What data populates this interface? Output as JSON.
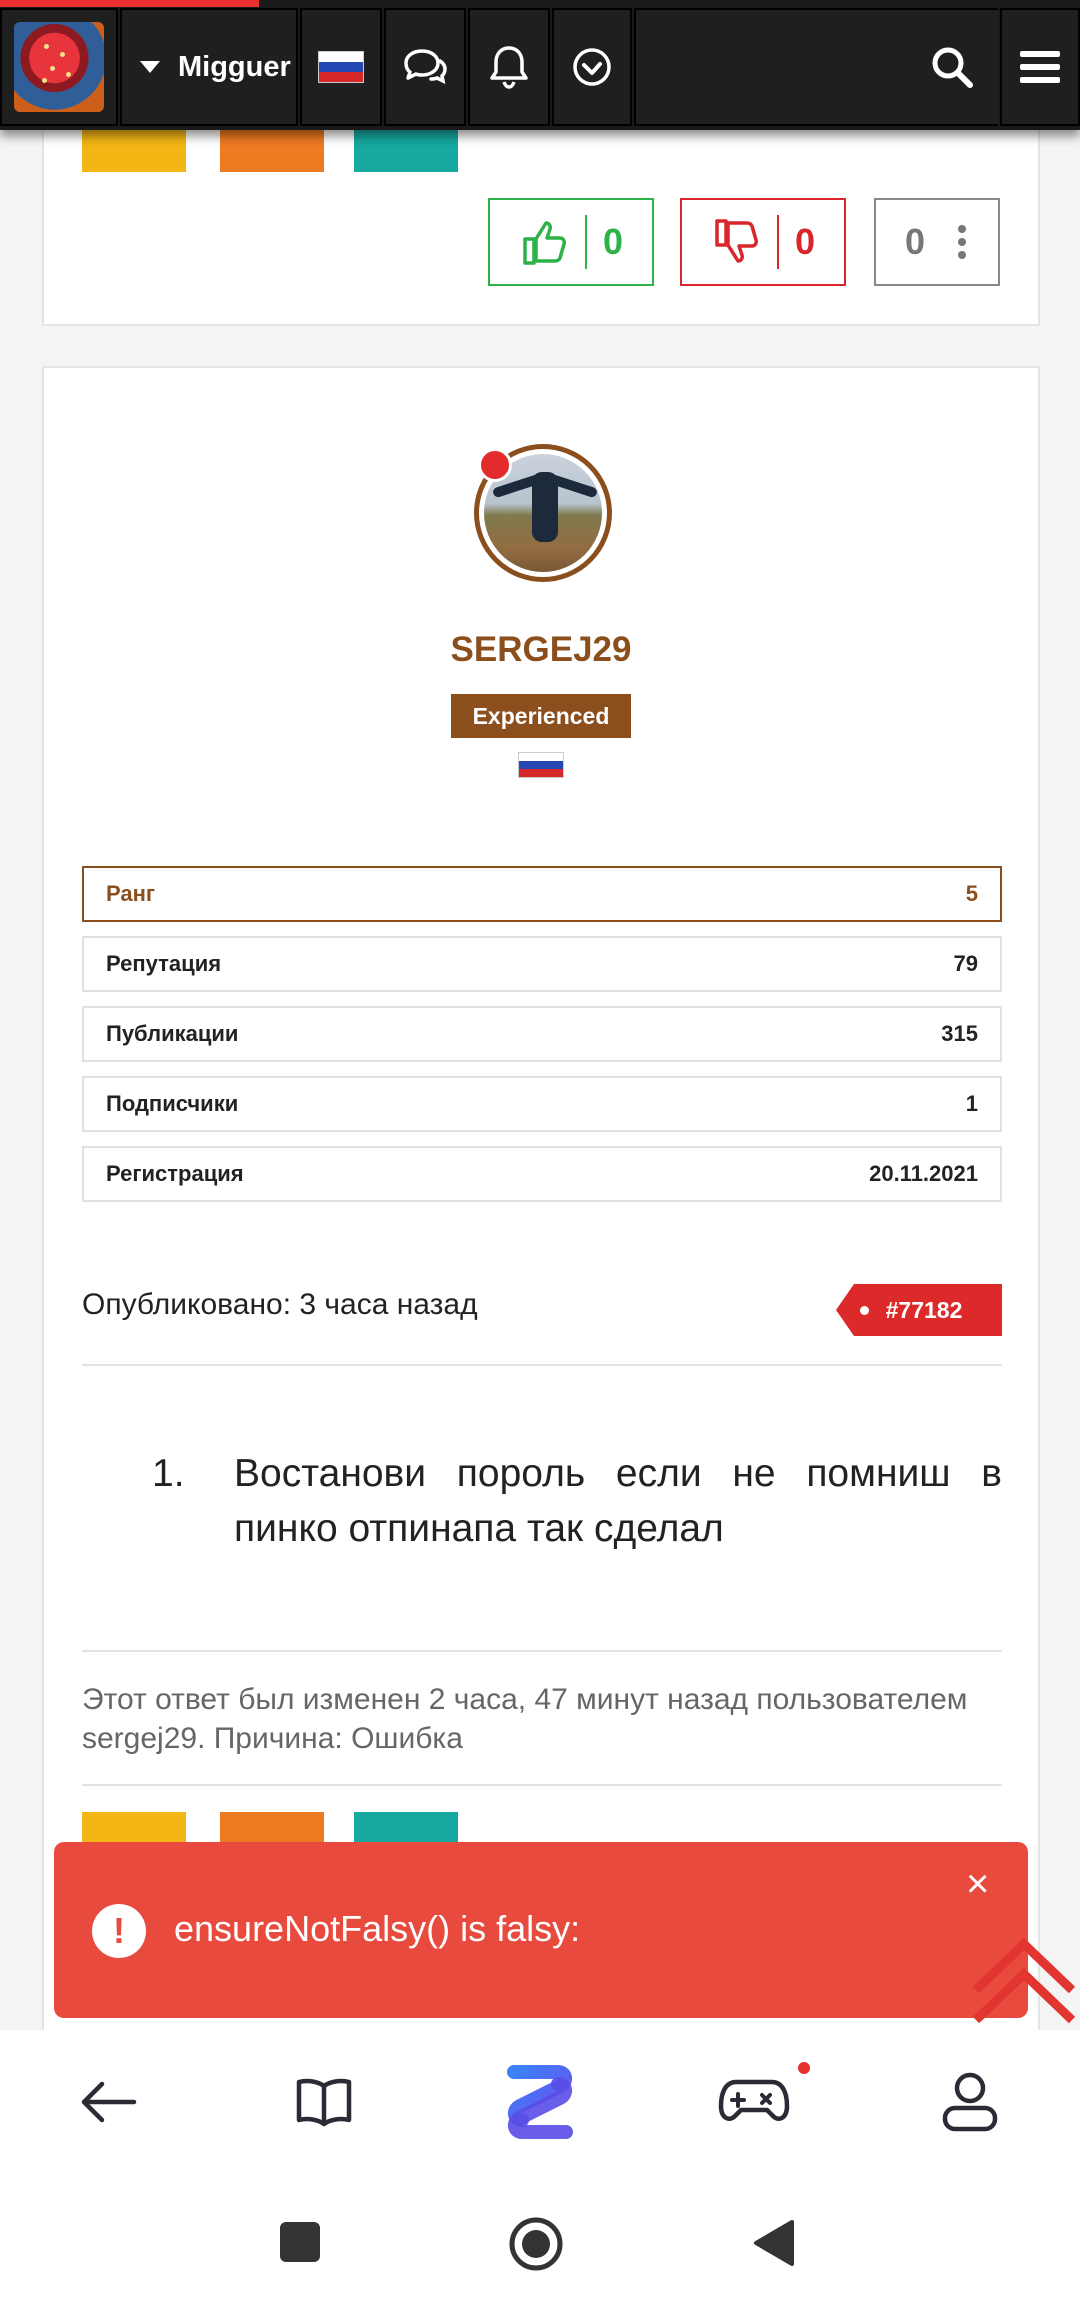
{
  "header": {
    "username": "Migguer",
    "progress_percent": 24
  },
  "post_actions": {
    "likes": "0",
    "dislikes": "0",
    "score": "0"
  },
  "profile": {
    "username": "SERGEJ29",
    "rank_title": "Experienced",
    "stats": [
      {
        "label": "Ранг",
        "value": "5"
      },
      {
        "label": "Репутация",
        "value": "79"
      },
      {
        "label": "Публикации",
        "value": "315"
      },
      {
        "label": "Подписчики",
        "value": "1"
      },
      {
        "label": "Регистрация",
        "value": "20.11.2021"
      }
    ]
  },
  "post": {
    "published": "Опубликовано: 3 часа назад",
    "id": "#77182",
    "list_number": "1.",
    "text": "Востанови пороль если не помниш в пинко отпинапа так сделал",
    "edit_note": "Этот ответ был изменен 2 часа, 47 минут назад пользователем sergej29. Причина: Ошибка"
  },
  "toast": {
    "message": "ensureNotFalsy() is falsy:",
    "close": "×"
  },
  "icons": {
    "nav": [
      "back-arrow-icon",
      "book-icon",
      "app-logo-icon",
      "gamepad-icon",
      "profile-icon"
    ],
    "system": [
      "recents-square-icon",
      "home-circle-icon",
      "back-triangle-icon"
    ]
  },
  "colors": {
    "accent": "#8a4f1d",
    "like": "#2db24a",
    "dislike": "#d8262c",
    "error": "#e84a3e",
    "header": "#1a1a1a"
  }
}
